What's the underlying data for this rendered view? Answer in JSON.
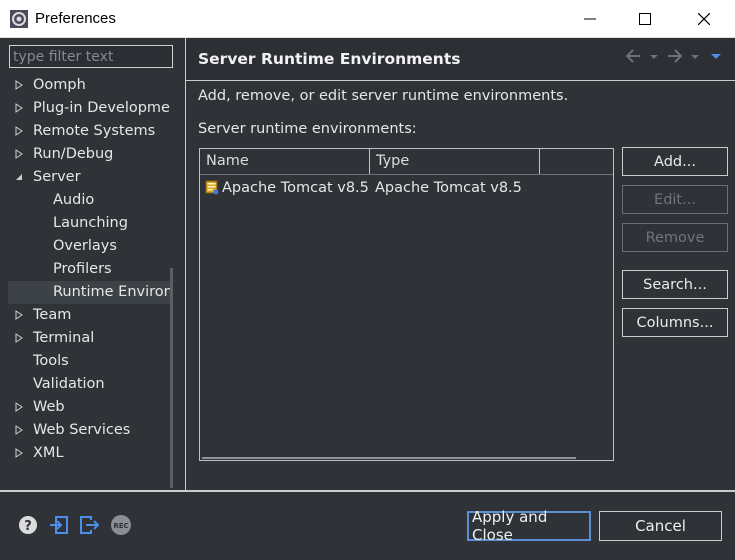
{
  "window": {
    "title": "Preferences"
  },
  "filter": {
    "placeholder": "type filter text"
  },
  "tree": {
    "items": [
      {
        "label": "Oomph",
        "expandable": true
      },
      {
        "label": "Plug-in Development",
        "expandable": true
      },
      {
        "label": "Remote Systems",
        "expandable": true
      },
      {
        "label": "Run/Debug",
        "expandable": true
      },
      {
        "label": "Server",
        "expanded": true
      },
      {
        "label": "Audio",
        "child": true
      },
      {
        "label": "Launching",
        "child": true
      },
      {
        "label": "Overlays",
        "child": true
      },
      {
        "label": "Profilers",
        "child": true
      },
      {
        "label": "Runtime Environments",
        "child": true,
        "selected": true
      },
      {
        "label": "Team",
        "expandable": true
      },
      {
        "label": "Terminal",
        "expandable": true
      },
      {
        "label": "Tools"
      },
      {
        "label": "Validation"
      },
      {
        "label": "Web",
        "expandable": true
      },
      {
        "label": "Web Services",
        "expandable": true
      },
      {
        "label": "XML",
        "expandable": true
      }
    ]
  },
  "page": {
    "title": "Server Runtime Environments",
    "description": "Add, remove, or edit server runtime environments.",
    "list_label": "Server runtime environments:"
  },
  "table": {
    "columns": [
      "Name",
      "Type"
    ],
    "rows": [
      {
        "name": "Apache Tomcat v8.5",
        "type": "Apache Tomcat v8.5"
      }
    ]
  },
  "buttons": {
    "add": "Add...",
    "edit": "Edit...",
    "remove": "Remove",
    "search": "Search...",
    "columns": "Columns..."
  },
  "footer": {
    "apply_close": "Apply and Close",
    "cancel": "Cancel",
    "rec_label": "REC"
  },
  "colors": {
    "background": "#2f3338",
    "accent_icon": "#4c8ee8",
    "default_button_border": "#5a8fd6"
  }
}
